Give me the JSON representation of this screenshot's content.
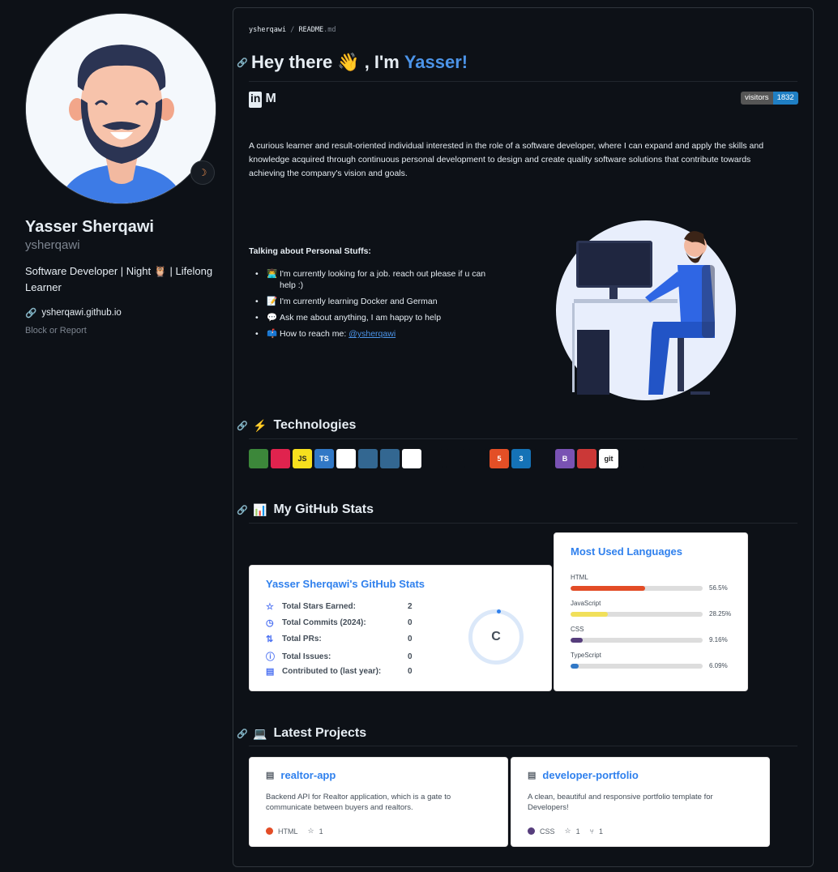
{
  "profile": {
    "name": "Yasser Sherqawi",
    "login": "ysherqawi",
    "bio": "Software Developer | Night 🦉 | Lifelong Learner",
    "website": "ysherqawi.github.io",
    "block_report": "Block or Report",
    "status_icon": "moon-icon"
  },
  "readme": {
    "crumb_user": "ysherqawi",
    "crumb_sep": "/",
    "crumb_file": "README",
    "crumb_ext": ".md",
    "heading_prefix": "Hey there",
    "heading_emoji": "👋",
    "heading_mid": ", I'm",
    "heading_accent": "Yasser!",
    "social_linkedin": "in",
    "social_medium": "M",
    "badge_label": "visitors",
    "badge_count": "1832",
    "about": "A curious learner and result-oriented individual interested in the role of a software developer, where I can expand and apply the skills and knowledge acquired through continuous personal development to design and create quality software solutions that contribute towards achieving the company's vision and goals.",
    "personal_title": "Talking about Personal Stuffs:",
    "personal_items": [
      {
        "emoji": "👨‍💻",
        "text": "I'm currently looking for a job. reach out please if u can help :)"
      },
      {
        "emoji": "📝",
        "text": "I'm currently learning Docker and German"
      },
      {
        "emoji": "💬",
        "text": "Ask me about anything, I am happy to help"
      },
      {
        "emoji": "📫",
        "text": "How to reach me: ",
        "link": "@ysherqawi"
      }
    ],
    "tech_title": "Technologies",
    "tech_emoji": "⚡",
    "stats_title": "My GitHub Stats",
    "stats_emoji": "📊",
    "projects_title": "Latest Projects",
    "projects_emoji": "💻"
  },
  "tech_icons": [
    {
      "name": "nodejs-icon",
      "label": "",
      "bg": "#3c873a"
    },
    {
      "name": "nestjs-icon",
      "label": "",
      "bg": "#e0234e"
    },
    {
      "name": "javascript-icon",
      "label": "JS",
      "bg": "#f7df1e"
    },
    {
      "name": "typescript-icon",
      "label": "TS",
      "bg": "#3178c6"
    },
    {
      "name": "postgresql-icon",
      "label": "",
      "bg": "#ffffff"
    },
    {
      "name": "database-icon",
      "label": "",
      "bg": "#336791"
    },
    {
      "name": "postgres-elephant-icon",
      "label": "",
      "bg": "#336791"
    },
    {
      "name": "mysql-icon",
      "label": "",
      "bg": "#ffffff"
    },
    {
      "name": "react-icon",
      "label": "",
      "bg": "#0d1117"
    },
    {
      "name": "react-native-icon",
      "label": "",
      "bg": "#0d1117"
    },
    {
      "name": "graphql-icon",
      "label": "",
      "bg": "#0d1117"
    },
    {
      "name": "html5-icon",
      "label": "5",
      "bg": "#e34f26"
    },
    {
      "name": "css3-icon",
      "label": "3",
      "bg": "#1572b6"
    },
    {
      "name": "sass-icon",
      "label": "",
      "bg": "#0d1117"
    },
    {
      "name": "bootstrap-icon",
      "label": "B",
      "bg": "#7952b3"
    },
    {
      "name": "npm-icon",
      "label": "",
      "bg": "#cb3837"
    },
    {
      "name": "git-icon",
      "label": "git",
      "bg": "#ffffff"
    },
    {
      "name": "vercel-icon",
      "label": "",
      "bg": "#0d1117"
    },
    {
      "name": "docker-icon",
      "label": "",
      "bg": "#0d1117"
    }
  ],
  "stats_card": {
    "title": "Yasser Sherqawi's GitHub Stats",
    "rows": [
      {
        "icon": "star-icon",
        "label": "Total Stars Earned:",
        "value": "2"
      },
      {
        "icon": "history-icon",
        "label": "Total Commits (2024):",
        "value": "0"
      },
      {
        "icon": "pull-request-icon",
        "label": "Total PRs:",
        "value": "0"
      },
      {
        "icon": "issue-icon",
        "label": "Total Issues:",
        "value": "0"
      },
      {
        "icon": "repo-icon",
        "label": "Contributed to (last year):",
        "value": "0"
      }
    ],
    "rank": "C"
  },
  "languages_card": {
    "title": "Most Used Languages",
    "items": [
      {
        "name": "HTML",
        "pct_label": "56.5%",
        "fraction": 0.565,
        "color": "#e34c26"
      },
      {
        "name": "JavaScript",
        "pct_label": "28.25%",
        "fraction": 0.2825,
        "color": "#f1e05a"
      },
      {
        "name": "CSS",
        "pct_label": "9.16%",
        "fraction": 0.0916,
        "color": "#563d7c"
      },
      {
        "name": "TypeScript",
        "pct_label": "6.09%",
        "fraction": 0.0609,
        "color": "#3178c6"
      }
    ]
  },
  "projects": [
    {
      "name": "realtor-app",
      "desc": "Backend API for Realtor application, which is a gate to communicate between buyers and realtors.",
      "lang": "HTML",
      "lang_color": "#e34c26",
      "stars": "1",
      "forks": ""
    },
    {
      "name": "developer-portfolio",
      "desc": "A clean, beautiful and responsive portfolio template for Developers!",
      "lang": "CSS",
      "lang_color": "#563d7c",
      "stars": "1",
      "forks": "1"
    }
  ]
}
